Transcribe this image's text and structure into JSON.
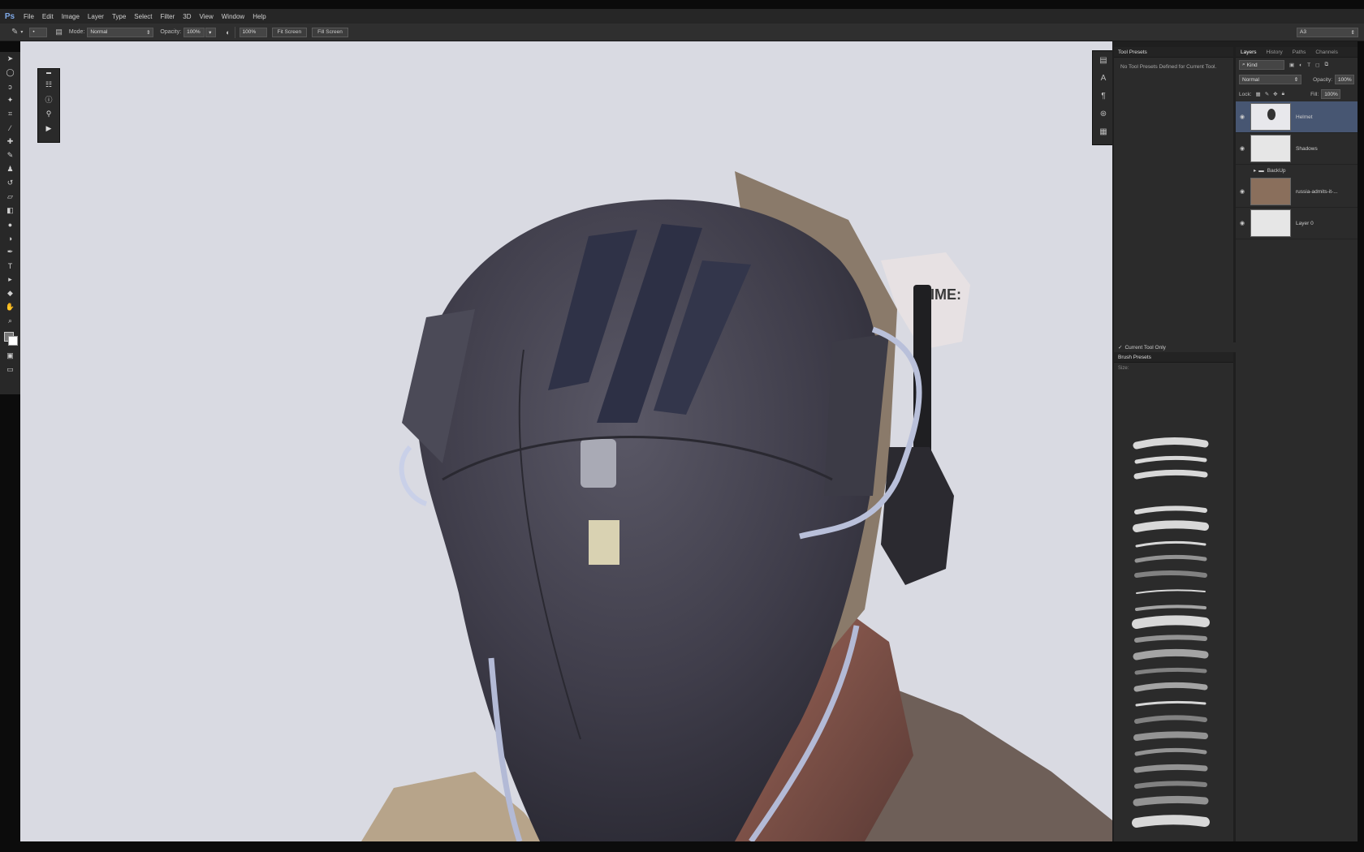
{
  "app": {
    "logo": "Ps",
    "menu": [
      "File",
      "Edit",
      "Image",
      "Layer",
      "Type",
      "Select",
      "Filter",
      "3D",
      "View",
      "Window",
      "Help"
    ]
  },
  "options": {
    "mode_label": "Mode:",
    "mode_value": "Normal",
    "opacity_label": "Opacity:",
    "opacity_value": "100%",
    "zoom_value": "100%",
    "fit_screen": "Fit Screen",
    "fill_screen": "Fill Screen",
    "workspace": "A3"
  },
  "tool_presets": {
    "title": "Tool Presets",
    "message": "No Tool Presets Defined for Current Tool.",
    "current_tool_only": "Current Tool Only"
  },
  "brush_presets": {
    "title": "Brush Presets",
    "size_label": "Size:"
  },
  "layers_panel": {
    "tabs": [
      "Layers",
      "History",
      "Paths",
      "Channels"
    ],
    "filter": "Kind",
    "blend_mode": "Normal",
    "opacity_label": "Opacity:",
    "opacity_value": "100%",
    "lock_label": "Lock:",
    "fill_label": "Fill:",
    "fill_value": "100%",
    "layers": [
      {
        "name": "Helmet",
        "selected": true
      },
      {
        "name": "Shadows",
        "selected": false
      },
      {
        "name": "BackUp",
        "group": true
      },
      {
        "name": "russia-admits-it-...",
        "selected": false
      },
      {
        "name": "Layer 0",
        "selected": false
      }
    ]
  },
  "canvas": {
    "helmet_label": "TIME:"
  },
  "colors": {
    "selected_layer": "#475672",
    "canvas_bg": "#d9dae2",
    "panel_bg": "#2b2b2b"
  }
}
